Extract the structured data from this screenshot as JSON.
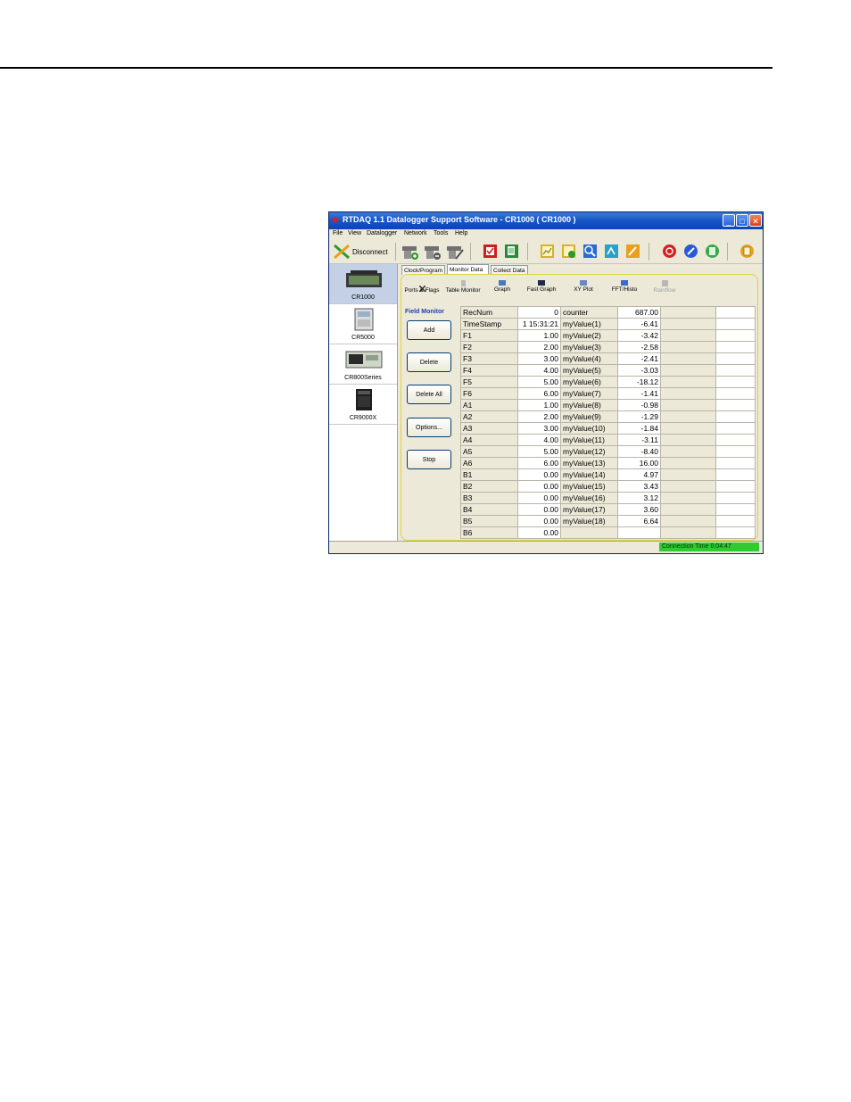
{
  "window": {
    "title": "RTDAQ 1.1 Datalogger Support Software - CR1000 ( CR1000 )",
    "minimize_glyph": "_",
    "maximize_glyph": "□",
    "close_glyph": "✕"
  },
  "menu": [
    "File",
    "View",
    "Datalogger",
    "Network",
    "Tools",
    "Help"
  ],
  "toolbar": {
    "disconnect_label": "Disconnect",
    "icons": [
      "add-device-icon",
      "remove-device-icon",
      "edit-device-icon",
      "check-program-icon",
      "copy-program-icon",
      "view-data-icon",
      "graph-data-icon",
      "inspect-icon",
      "export-icon",
      "edit-icon",
      "stop-red-icon",
      "pen-icon",
      "calculator-icon",
      "exit-icon"
    ]
  },
  "devices": [
    {
      "label": "CR1000",
      "selected": true
    },
    {
      "label": "CR5000",
      "selected": false
    },
    {
      "label": "CR800Series",
      "selected": false
    },
    {
      "label": "CR9000X",
      "selected": false
    }
  ],
  "tabs": [
    "Clock/Program",
    "Monitor Data",
    "Collect Data"
  ],
  "subtools": [
    {
      "label": "Ports & Flags",
      "enabled": true
    },
    {
      "label": "Table Monitor",
      "enabled": true
    },
    {
      "label": "Graph",
      "enabled": true
    },
    {
      "label": "Fast Graph",
      "enabled": true
    },
    {
      "label": "XY Plot",
      "enabled": true
    },
    {
      "label": "FFT/Histo",
      "enabled": true
    },
    {
      "label": "Rainflow",
      "enabled": false
    }
  ],
  "field_monitor": {
    "title": "Field Monitor",
    "buttons": [
      "Add",
      "Delete",
      "Delete All",
      "Options...",
      "Stop"
    ]
  },
  "grid": {
    "rows": [
      [
        "RecNum",
        "0",
        "counter",
        "687.00"
      ],
      [
        "TimeStamp",
        "1 15:31:21",
        "myValue(1)",
        "-6.41"
      ],
      [
        "F1",
        "1.00",
        "myValue(2)",
        "-3.42"
      ],
      [
        "F2",
        "2.00",
        "myValue(3)",
        "-2.58"
      ],
      [
        "F3",
        "3.00",
        "myValue(4)",
        "-2.41"
      ],
      [
        "F4",
        "4.00",
        "myValue(5)",
        "-3.03"
      ],
      [
        "F5",
        "5.00",
        "myValue(6)",
        "-18.12"
      ],
      [
        "F6",
        "6.00",
        "myValue(7)",
        "-1.41"
      ],
      [
        "A1",
        "1.00",
        "myValue(8)",
        "-0.98"
      ],
      [
        "A2",
        "2.00",
        "myValue(9)",
        "-1.29"
      ],
      [
        "A3",
        "3.00",
        "myValue(10)",
        "-1.84"
      ],
      [
        "A4",
        "4.00",
        "myValue(11)",
        "-3.11"
      ],
      [
        "A5",
        "5.00",
        "myValue(12)",
        "-8.40"
      ],
      [
        "A6",
        "6.00",
        "myValue(13)",
        "16.00"
      ],
      [
        "B1",
        "0.00",
        "myValue(14)",
        "4.97"
      ],
      [
        "B2",
        "0.00",
        "myValue(15)",
        "3.43"
      ],
      [
        "B3",
        "0.00",
        "myValue(16)",
        "3.12"
      ],
      [
        "B4",
        "0.00",
        "myValue(17)",
        "3.60"
      ],
      [
        "B5",
        "0.00",
        "myValue(18)",
        "6.64"
      ],
      [
        "B6",
        "0.00",
        "",
        ""
      ]
    ]
  },
  "status": {
    "connection_time": "Connection Time 0:04:47"
  },
  "colors": {
    "titlebar": "#1a57c7",
    "connection_bar": "#2ecc2e",
    "content_border": "#e0d040"
  }
}
